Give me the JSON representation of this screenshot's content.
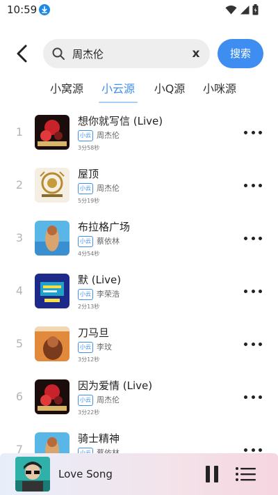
{
  "status_bar": {
    "time": "10:59"
  },
  "search": {
    "query": "周杰伦",
    "clear_label": "x",
    "button_label": "搜索"
  },
  "tabs": [
    {
      "label": "小窝源"
    },
    {
      "label": "小云源"
    },
    {
      "label": "小Q源"
    },
    {
      "label": "小咪源"
    }
  ],
  "active_tab": "小云源",
  "songs": [
    {
      "index": "1",
      "title": "想你就写信 (Live)",
      "source": "小云",
      "artist": "周杰伦",
      "duration": "3分58秒"
    },
    {
      "index": "2",
      "title": "屋顶",
      "source": "小云",
      "artist": "周杰伦",
      "duration": "5分19秒"
    },
    {
      "index": "3",
      "title": "布拉格广场",
      "source": "小云",
      "artist": "蔡依林",
      "duration": "4分54秒"
    },
    {
      "index": "4",
      "title": "默 (Live)",
      "source": "小云",
      "artist": "李荣浩",
      "duration": "2分13秒"
    },
    {
      "index": "5",
      "title": "刀马旦",
      "source": "小云",
      "artist": "李玟",
      "duration": "3分12秒"
    },
    {
      "index": "6",
      "title": "因为爱情 (Live)",
      "source": "小云",
      "artist": "周杰伦",
      "duration": "3分22秒"
    },
    {
      "index": "7",
      "title": "骑士精神",
      "source": "小云",
      "artist": "蔡依林",
      "duration": ""
    }
  ],
  "player": {
    "title": "Love Song"
  },
  "colors": {
    "accent": "#3d8ef0",
    "download_badge": "#1e88e5",
    "index_gray": "#b4b4b4"
  }
}
